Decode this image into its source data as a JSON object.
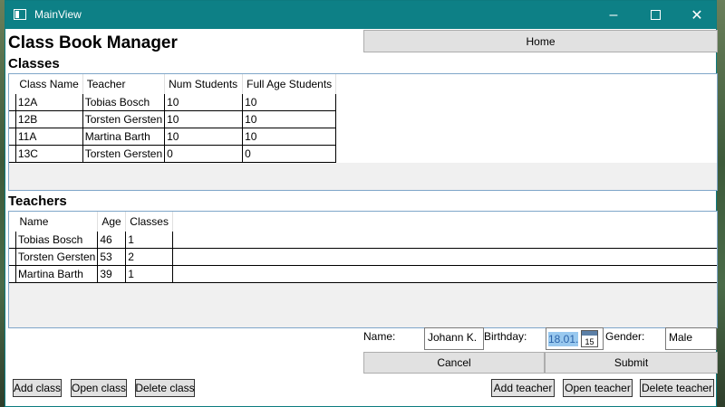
{
  "window": {
    "title": "MainView"
  },
  "header": {
    "app_title": "Class Book Manager",
    "home_label": "Home"
  },
  "classes": {
    "title": "Classes",
    "columns": [
      "Class Name",
      "Teacher",
      "Num Students",
      "Full Age Students"
    ],
    "rows": [
      [
        "12A",
        "Tobias Bosch",
        "10",
        "10"
      ],
      [
        "12B",
        "Torsten Gersten",
        "10",
        "10"
      ],
      [
        "11A",
        "Martina Barth",
        "10",
        "10"
      ],
      [
        "13C",
        "Torsten Gersten",
        "0",
        "0"
      ]
    ]
  },
  "teachers": {
    "title": "Teachers",
    "columns": [
      "Name",
      "Age",
      "Classes"
    ],
    "rows": [
      [
        "Tobias Bosch",
        "46",
        "1"
      ],
      [
        "Torsten Gersten",
        "53",
        "2"
      ],
      [
        "Martina Barth",
        "39",
        "1"
      ]
    ]
  },
  "form": {
    "name_label": "Name:",
    "name_value": "Johann K.",
    "birthday_label": "Birthday:",
    "birthday_value": "18.01.",
    "calendar_day": "15",
    "gender_label": "Gender:",
    "gender_value": "Male",
    "cancel_label": "Cancel",
    "submit_label": "Submit"
  },
  "buttons": {
    "add_class": "Add class",
    "open_class": "Open class",
    "delete_class": "Delete class",
    "add_teacher": "Add teacher",
    "open_teacher": "Open teacher",
    "delete_teacher": "Delete teacher"
  }
}
